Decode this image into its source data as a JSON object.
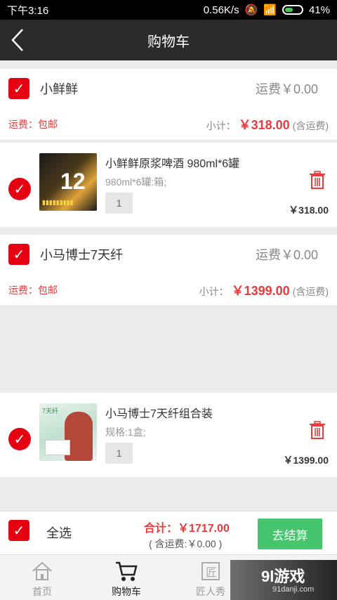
{
  "status": {
    "time": "下午3:16",
    "speed": "0.56K/s",
    "battery": "41%"
  },
  "header": {
    "title": "购物车"
  },
  "shops": [
    {
      "name": "小鲜鲜",
      "freight": "运费￥0.00",
      "ship_tag": "运费：包邮",
      "subtotal_label": "小计：",
      "subtotal_amount": "￥318.00",
      "subtotal_note": "(含运费)",
      "item": {
        "title": "小鲜鲜原浆啤酒 980ml*6罐",
        "spec": "980ml*6罐:箱;",
        "qty": "1",
        "price": "￥318.00"
      }
    },
    {
      "name": "小马博士7天纤",
      "freight": "运费￥0.00",
      "ship_tag": "运费：包邮",
      "subtotal_label": "小计：",
      "subtotal_amount": "￥1399.00",
      "subtotal_note": "(含运费)",
      "item": {
        "title": "小马博士7天纤组合装",
        "spec": "规格:1盒;",
        "qty": "1",
        "price": "￥1399.00"
      }
    }
  ],
  "footer": {
    "select_all": "全选",
    "total": "合计：￥1717.00",
    "total_sub": "( 含运费:￥0.00 )",
    "checkout": "去结算"
  },
  "nav": [
    "首页",
    "购物车",
    "匠人秀"
  ],
  "watermark": {
    "logo": "9l游戏",
    "url": "91danji.com"
  },
  "colors": {
    "accent": "#e60012",
    "price": "#e83a3a",
    "checkout": "#47c46e",
    "header": "#2b2b2b"
  }
}
